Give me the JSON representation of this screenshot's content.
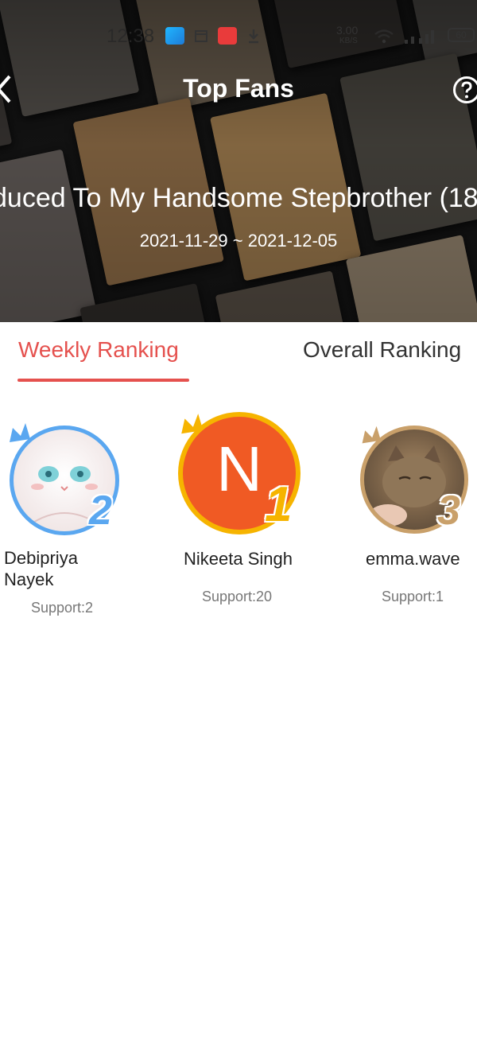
{
  "status_bar": {
    "time": "12:38",
    "net_speed": "3.00",
    "net_unit": "KB/S",
    "battery": "60",
    "icons": [
      "app-icon",
      "calendar-icon",
      "mangatoon-app-icon",
      "download-icon",
      "wifi-icon",
      "signal-icon",
      "battery-icon"
    ]
  },
  "header": {
    "title": "Top Fans",
    "back_icon": "chevron-left-icon",
    "help_icon": "question-circle-icon"
  },
  "book": {
    "title": "duced To My Handsome Stepbrother (18",
    "date_range": "2021-11-29 ~ 2021-12-05"
  },
  "tabs": [
    {
      "label": "Weekly Ranking",
      "active": true
    },
    {
      "label": "Overall Ranking",
      "active": false
    }
  ],
  "ranking": [
    {
      "rank": "2",
      "name": "Debipriya Nayek",
      "support": "Support:2",
      "avatar": "white-cat-illustration",
      "accent": "#5aa7f0"
    },
    {
      "rank": "1",
      "name": "Nikeeta Singh",
      "support": "Support:20",
      "avatar_letter": "N",
      "accent": "#f6b400",
      "avatar_color": "#f05a24"
    },
    {
      "rank": "3",
      "name": "emma.wave",
      "support": "Support:1",
      "avatar": "cat-photo",
      "accent": "#c9a06a"
    }
  ],
  "colors": {
    "accent": "#e5514e",
    "text": "#222222",
    "muted": "#777777"
  }
}
